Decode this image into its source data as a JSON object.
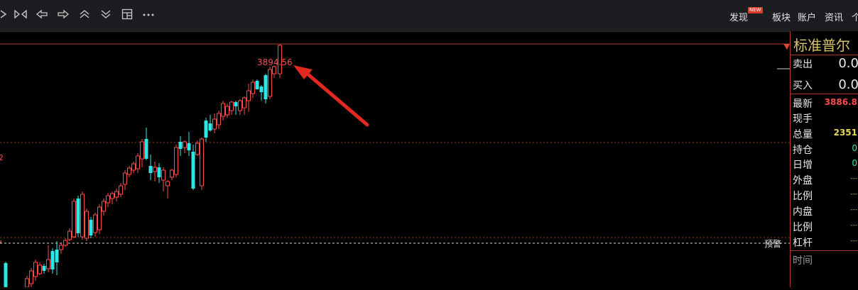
{
  "toolbar": {
    "icons": [
      "nav-next-icon",
      "nav-first-last-icon",
      "arrow-left-icon",
      "arrow-right-icon",
      "double-up-icon",
      "double-down-icon",
      "layout-grid-icon",
      "more-icon"
    ],
    "menu": {
      "discover": "发现",
      "new_badge": "NEW",
      "sectors": "板块",
      "account": "账户",
      "news": "资讯",
      "more": "个"
    }
  },
  "chart": {
    "high_label": "3894.56",
    "left_edge_label": "2",
    "warning_label": "预警",
    "colors": {
      "up": "#ff4a4a",
      "down": "#2fe6e6",
      "background": "#000000"
    }
  },
  "panel": {
    "title": "标准普尔",
    "sell_label": "卖出",
    "sell_value": "0.0",
    "buy_label": "买入",
    "buy_value": "0.0",
    "latest_label": "最新",
    "latest_value": "3886.8",
    "current_hand_label": "现手",
    "total_volume_label": "总量",
    "total_volume_value": "2351",
    "open_interest_label": "持仓",
    "open_interest_value": "0",
    "daily_increase_label": "日增",
    "daily_increase_value": "0",
    "outer_label": "外盘",
    "outer_value": "---",
    "ratio1_label": "比例",
    "ratio1_value": "---",
    "inner_label": "内盘",
    "inner_value": "---",
    "ratio2_label": "比例",
    "ratio2_value": "---",
    "leverage_label": "杠杆",
    "leverage_value": "---",
    "time_label": "时间"
  }
}
